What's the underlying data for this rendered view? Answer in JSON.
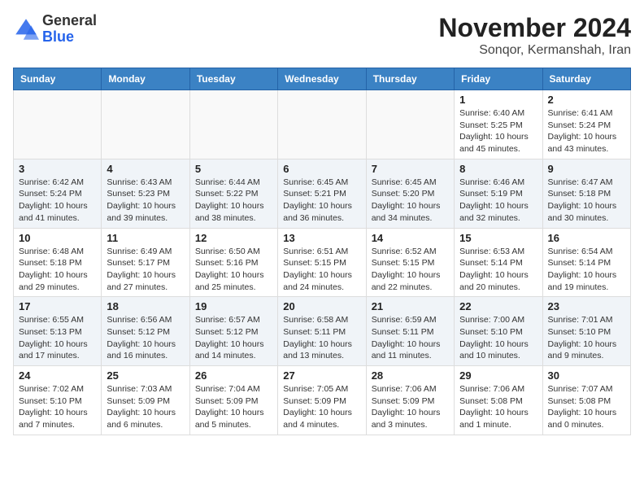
{
  "logo": {
    "general": "General",
    "blue": "Blue"
  },
  "title": {
    "month_year": "November 2024",
    "location": "Sonqor, Kermanshah, Iran"
  },
  "headers": [
    "Sunday",
    "Monday",
    "Tuesday",
    "Wednesday",
    "Thursday",
    "Friday",
    "Saturday"
  ],
  "weeks": [
    {
      "days": [
        {
          "number": "",
          "info": "",
          "empty": true
        },
        {
          "number": "",
          "info": "",
          "empty": true
        },
        {
          "number": "",
          "info": "",
          "empty": true
        },
        {
          "number": "",
          "info": "",
          "empty": true
        },
        {
          "number": "",
          "info": "",
          "empty": true
        },
        {
          "number": "1",
          "info": "Sunrise: 6:40 AM\nSunset: 5:25 PM\nDaylight: 10 hours and 45 minutes.",
          "empty": false
        },
        {
          "number": "2",
          "info": "Sunrise: 6:41 AM\nSunset: 5:24 PM\nDaylight: 10 hours and 43 minutes.",
          "empty": false
        }
      ]
    },
    {
      "days": [
        {
          "number": "3",
          "info": "Sunrise: 6:42 AM\nSunset: 5:24 PM\nDaylight: 10 hours and 41 minutes.",
          "empty": false
        },
        {
          "number": "4",
          "info": "Sunrise: 6:43 AM\nSunset: 5:23 PM\nDaylight: 10 hours and 39 minutes.",
          "empty": false
        },
        {
          "number": "5",
          "info": "Sunrise: 6:44 AM\nSunset: 5:22 PM\nDaylight: 10 hours and 38 minutes.",
          "empty": false
        },
        {
          "number": "6",
          "info": "Sunrise: 6:45 AM\nSunset: 5:21 PM\nDaylight: 10 hours and 36 minutes.",
          "empty": false
        },
        {
          "number": "7",
          "info": "Sunrise: 6:45 AM\nSunset: 5:20 PM\nDaylight: 10 hours and 34 minutes.",
          "empty": false
        },
        {
          "number": "8",
          "info": "Sunrise: 6:46 AM\nSunset: 5:19 PM\nDaylight: 10 hours and 32 minutes.",
          "empty": false
        },
        {
          "number": "9",
          "info": "Sunrise: 6:47 AM\nSunset: 5:18 PM\nDaylight: 10 hours and 30 minutes.",
          "empty": false
        }
      ]
    },
    {
      "days": [
        {
          "number": "10",
          "info": "Sunrise: 6:48 AM\nSunset: 5:18 PM\nDaylight: 10 hours and 29 minutes.",
          "empty": false
        },
        {
          "number": "11",
          "info": "Sunrise: 6:49 AM\nSunset: 5:17 PM\nDaylight: 10 hours and 27 minutes.",
          "empty": false
        },
        {
          "number": "12",
          "info": "Sunrise: 6:50 AM\nSunset: 5:16 PM\nDaylight: 10 hours and 25 minutes.",
          "empty": false
        },
        {
          "number": "13",
          "info": "Sunrise: 6:51 AM\nSunset: 5:15 PM\nDaylight: 10 hours and 24 minutes.",
          "empty": false
        },
        {
          "number": "14",
          "info": "Sunrise: 6:52 AM\nSunset: 5:15 PM\nDaylight: 10 hours and 22 minutes.",
          "empty": false
        },
        {
          "number": "15",
          "info": "Sunrise: 6:53 AM\nSunset: 5:14 PM\nDaylight: 10 hours and 20 minutes.",
          "empty": false
        },
        {
          "number": "16",
          "info": "Sunrise: 6:54 AM\nSunset: 5:14 PM\nDaylight: 10 hours and 19 minutes.",
          "empty": false
        }
      ]
    },
    {
      "days": [
        {
          "number": "17",
          "info": "Sunrise: 6:55 AM\nSunset: 5:13 PM\nDaylight: 10 hours and 17 minutes.",
          "empty": false
        },
        {
          "number": "18",
          "info": "Sunrise: 6:56 AM\nSunset: 5:12 PM\nDaylight: 10 hours and 16 minutes.",
          "empty": false
        },
        {
          "number": "19",
          "info": "Sunrise: 6:57 AM\nSunset: 5:12 PM\nDaylight: 10 hours and 14 minutes.",
          "empty": false
        },
        {
          "number": "20",
          "info": "Sunrise: 6:58 AM\nSunset: 5:11 PM\nDaylight: 10 hours and 13 minutes.",
          "empty": false
        },
        {
          "number": "21",
          "info": "Sunrise: 6:59 AM\nSunset: 5:11 PM\nDaylight: 10 hours and 11 minutes.",
          "empty": false
        },
        {
          "number": "22",
          "info": "Sunrise: 7:00 AM\nSunset: 5:10 PM\nDaylight: 10 hours and 10 minutes.",
          "empty": false
        },
        {
          "number": "23",
          "info": "Sunrise: 7:01 AM\nSunset: 5:10 PM\nDaylight: 10 hours and 9 minutes.",
          "empty": false
        }
      ]
    },
    {
      "days": [
        {
          "number": "24",
          "info": "Sunrise: 7:02 AM\nSunset: 5:10 PM\nDaylight: 10 hours and 7 minutes.",
          "empty": false
        },
        {
          "number": "25",
          "info": "Sunrise: 7:03 AM\nSunset: 5:09 PM\nDaylight: 10 hours and 6 minutes.",
          "empty": false
        },
        {
          "number": "26",
          "info": "Sunrise: 7:04 AM\nSunset: 5:09 PM\nDaylight: 10 hours and 5 minutes.",
          "empty": false
        },
        {
          "number": "27",
          "info": "Sunrise: 7:05 AM\nSunset: 5:09 PM\nDaylight: 10 hours and 4 minutes.",
          "empty": false
        },
        {
          "number": "28",
          "info": "Sunrise: 7:06 AM\nSunset: 5:09 PM\nDaylight: 10 hours and 3 minutes.",
          "empty": false
        },
        {
          "number": "29",
          "info": "Sunrise: 7:06 AM\nSunset: 5:08 PM\nDaylight: 10 hours and 1 minute.",
          "empty": false
        },
        {
          "number": "30",
          "info": "Sunrise: 7:07 AM\nSunset: 5:08 PM\nDaylight: 10 hours and 0 minutes.",
          "empty": false
        }
      ]
    }
  ]
}
